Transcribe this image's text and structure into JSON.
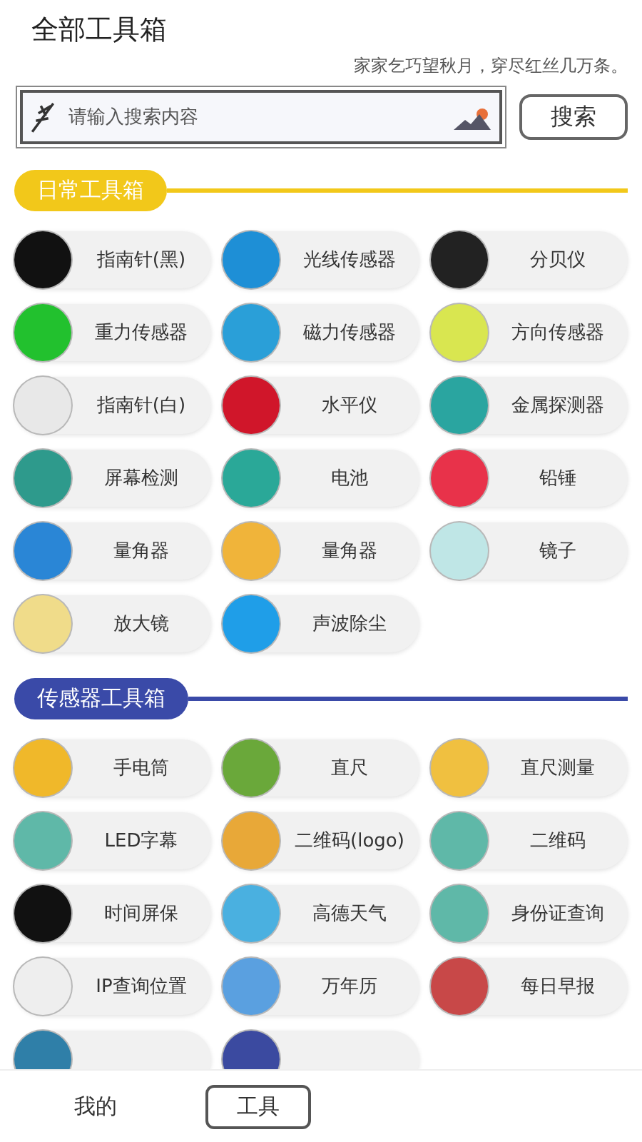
{
  "header": {
    "title": "全部工具箱",
    "motto": "家家乞巧望秋月，穿尽红丝几万条。"
  },
  "search": {
    "placeholder": "请输入搜索内容",
    "button": "搜索"
  },
  "sections": [
    {
      "title": "日常工具箱",
      "color": "#f2c81a",
      "tools": [
        {
          "label": "指南针(黑)",
          "color": "#111111"
        },
        {
          "label": "光线传感器",
          "color": "#1e8fd6"
        },
        {
          "label": "分贝仪",
          "color": "#222222"
        },
        {
          "label": "重力传感器",
          "color": "#22c12e"
        },
        {
          "label": "磁力传感器",
          "color": "#2a9fd8"
        },
        {
          "label": "方向传感器",
          "color": "#d9e650"
        },
        {
          "label": "指南针(白)",
          "color": "#e8e8e8"
        },
        {
          "label": "水平仪",
          "color": "#d0162a"
        },
        {
          "label": "金属探测器",
          "color": "#2aa5a0"
        },
        {
          "label": "屏幕检测",
          "color": "#2e9a8c"
        },
        {
          "label": "电池",
          "color": "#2aa898"
        },
        {
          "label": "铅锤",
          "color": "#e8324a"
        },
        {
          "label": "量角器",
          "color": "#2a86d6"
        },
        {
          "label": "量角器",
          "color": "#f0b43a"
        },
        {
          "label": "镜子",
          "color": "#bfe6e6"
        },
        {
          "label": "放大镜",
          "color": "#f0dc8a"
        },
        {
          "label": "声波除尘",
          "color": "#1f9ee8"
        }
      ]
    },
    {
      "title": "传感器工具箱",
      "color": "#3a4aa8",
      "tools": [
        {
          "label": "手电筒",
          "color": "#f0b82a"
        },
        {
          "label": "直尺",
          "color": "#6aa83a"
        },
        {
          "label": "直尺测量",
          "color": "#f0c040"
        },
        {
          "label": "LED字幕",
          "color": "#5fb8a8"
        },
        {
          "label": "二维码(logo)",
          "color": "#e8a838"
        },
        {
          "label": "二维码",
          "color": "#5fb8a8"
        },
        {
          "label": "时间屏保",
          "color": "#111111"
        },
        {
          "label": "高德天气",
          "color": "#4ab0e0"
        },
        {
          "label": "身份证查询",
          "color": "#5fb8a8"
        },
        {
          "label": "IP查询位置",
          "color": "#eeeeee"
        },
        {
          "label": "万年历",
          "color": "#5aa0e0"
        },
        {
          "label": "每日早报",
          "color": "#c84848"
        }
      ],
      "cut_tiles": [
        {
          "color": "#2f7fa8"
        },
        {
          "color": "#3b4aa0"
        }
      ]
    }
  ],
  "nav": [
    {
      "label": "我的",
      "selected": false
    },
    {
      "label": "工具",
      "selected": true
    }
  ]
}
